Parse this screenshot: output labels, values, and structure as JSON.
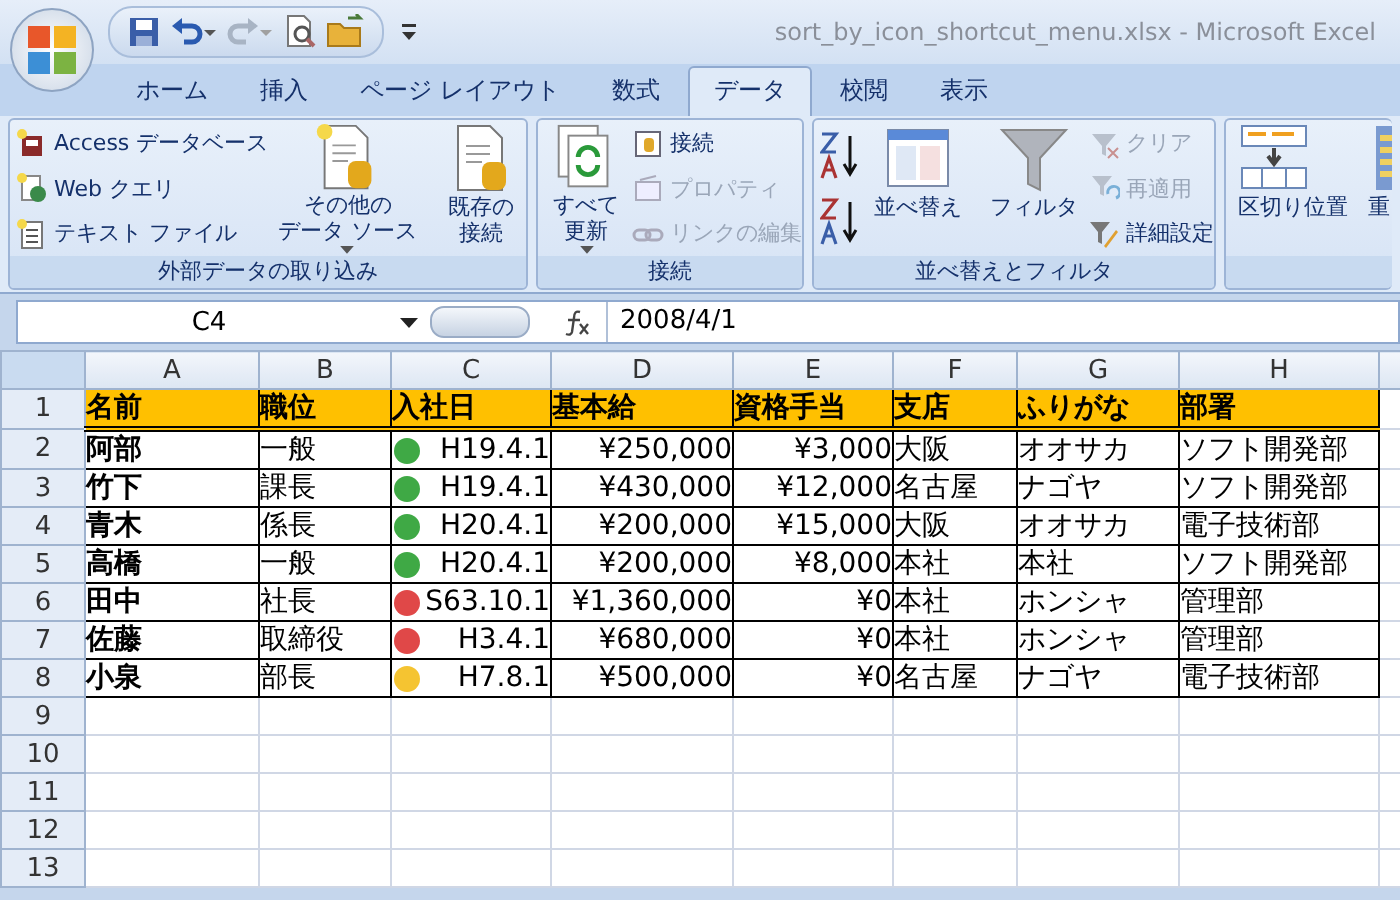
{
  "window": {
    "title": "sort_by_icon_shortcut_menu.xlsx - Microsoft Excel"
  },
  "tabs": [
    {
      "label": "ホーム",
      "selected": false
    },
    {
      "label": "挿入",
      "selected": false
    },
    {
      "label": "ページ レイアウト",
      "selected": false
    },
    {
      "label": "数式",
      "selected": false
    },
    {
      "label": "データ",
      "selected": true
    },
    {
      "label": "校閲",
      "selected": false
    },
    {
      "label": "表示",
      "selected": false
    }
  ],
  "ribbon": {
    "groups": [
      {
        "label": "外部データの取り込み",
        "items": [
          {
            "kind": "small-stack",
            "buttons": [
              {
                "label": "Access データベース",
                "disabled": false
              },
              {
                "label": "Web クエリ",
                "disabled": false
              },
              {
                "label": "テキスト ファイル",
                "disabled": false
              }
            ]
          },
          {
            "kind": "large",
            "lines": [
              "その他の",
              "データ ソース"
            ],
            "dropdown": true
          },
          {
            "kind": "separator"
          },
          {
            "kind": "large",
            "lines": [
              "既存の",
              "接続"
            ],
            "dropdown": false
          }
        ]
      },
      {
        "label": "接続",
        "items": [
          {
            "kind": "large",
            "lines": [
              "すべて",
              "更新"
            ],
            "dropdown": true
          },
          {
            "kind": "small-stack",
            "buttons": [
              {
                "label": "接続",
                "disabled": false
              },
              {
                "label": "プロパティ",
                "disabled": true
              },
              {
                "label": "リンクの編集",
                "disabled": true
              }
            ]
          }
        ]
      },
      {
        "label": "並べ替えとフィルタ",
        "items": [
          {
            "kind": "icon-stack"
          },
          {
            "kind": "large",
            "lines": [
              "並べ替え"
            ],
            "dropdown": false
          },
          {
            "kind": "separator"
          },
          {
            "kind": "large",
            "lines": [
              "フィルタ"
            ],
            "dropdown": false
          },
          {
            "kind": "small-stack",
            "buttons": [
              {
                "label": "クリア",
                "disabled": true
              },
              {
                "label": "再適用",
                "disabled": true
              },
              {
                "label": "詳細設定",
                "disabled": false
              }
            ]
          }
        ]
      },
      {
        "items": [
          {
            "kind": "large",
            "lines": [
              "区切り位置"
            ],
            "dropdown": false
          },
          {
            "kind": "large",
            "lines": [
              "重"
            ]
          }
        ]
      }
    ]
  },
  "formula_bar": {
    "name_box": "C4",
    "formula": "2008/4/1"
  },
  "sheet": {
    "columns": [
      "A",
      "B",
      "C",
      "D",
      "E",
      "F",
      "G",
      "H"
    ],
    "rows": [
      {
        "number": "1",
        "header": true,
        "cells": [
          "名前",
          "職位",
          "入社日",
          "基本給",
          "資格手当",
          "支店",
          "ふりがな",
          "部署"
        ]
      },
      {
        "number": "2",
        "header": false,
        "color": "#3fa945",
        "cells": [
          "阿部",
          "一般",
          "H19.4.1",
          "¥250,000",
          "¥3,000",
          "大阪",
          "オオサカ",
          "ソフト開発部"
        ]
      },
      {
        "number": "3",
        "header": false,
        "color": "#3fa945",
        "cells": [
          "竹下",
          "課長",
          "H19.4.1",
          "¥430,000",
          "¥12,000",
          "名古屋",
          "ナゴヤ",
          "ソフト開発部"
        ]
      },
      {
        "number": "4",
        "header": false,
        "color": "#3fa945",
        "cells": [
          "青木",
          "係長",
          "H20.4.1",
          "¥200,000",
          "¥15,000",
          "大阪",
          "オオサカ",
          "電子技術部"
        ]
      },
      {
        "number": "5",
        "header": false,
        "color": "#3fa945",
        "cells": [
          "高橋",
          "一般",
          "H20.4.1",
          "¥200,000",
          "¥8,000",
          "本社",
          "本社",
          "ソフト開発部"
        ]
      },
      {
        "number": "6",
        "header": false,
        "color": "#e04848",
        "cells": [
          "田中",
          "社長",
          "S63.10.1",
          "¥1,360,000",
          "¥0",
          "本社",
          "ホンシャ",
          "管理部"
        ]
      },
      {
        "number": "7",
        "header": false,
        "color": "#e04848",
        "cells": [
          "佐藤",
          "取締役",
          "H3.4.1",
          "¥680,000",
          "¥0",
          "本社",
          "ホンシャ",
          "管理部"
        ]
      },
      {
        "number": "8",
        "header": false,
        "color": "#f5c431",
        "cells": [
          "小泉",
          "部長",
          "H7.8.1",
          "¥500,000",
          "¥0",
          "名古屋",
          "ナゴヤ",
          "電子技術部"
        ]
      },
      {
        "number": "9"
      },
      {
        "number": "10"
      },
      {
        "number": "11"
      },
      {
        "number": "12"
      },
      {
        "number": "13"
      }
    ]
  }
}
